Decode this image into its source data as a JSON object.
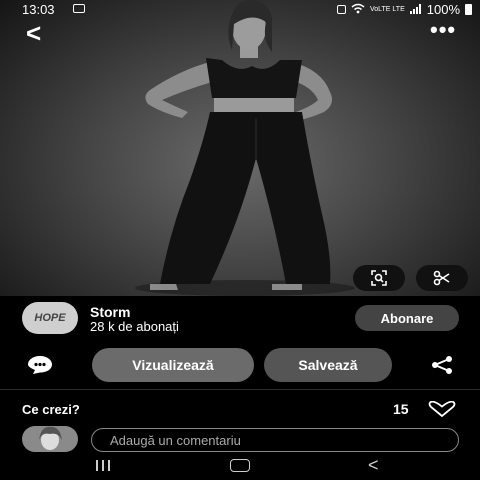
{
  "status_bar": {
    "time": "13:03",
    "network": "VoLTE LTE",
    "battery": "100%"
  },
  "pin": {
    "author": {
      "name": "Storm",
      "avatar_text": "HOPE",
      "subscribers": "28 k de abonați"
    },
    "follow_label": "Abonare",
    "view_label": "Vizualizează",
    "save_label": "Salvează",
    "prompt": "Ce crezi?",
    "reaction_count": "15",
    "comment_placeholder": "Adaugă un comentariu"
  }
}
